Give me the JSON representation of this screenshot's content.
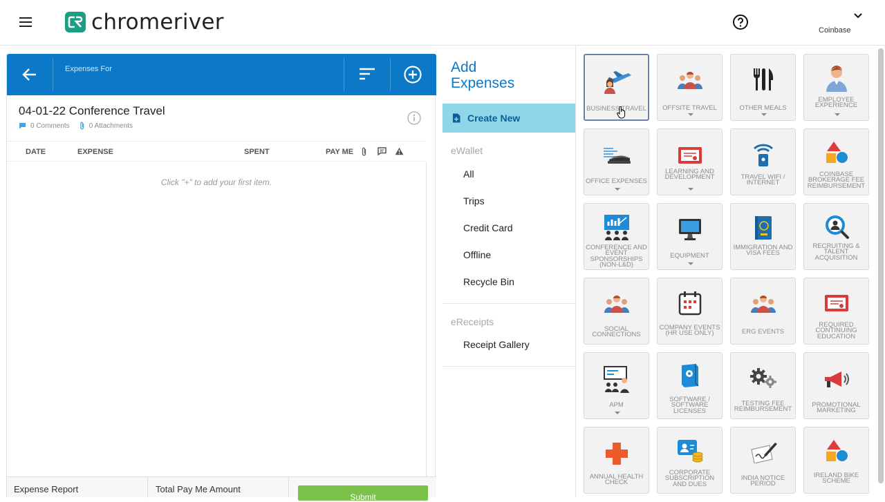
{
  "header": {
    "brand": "chromeriver",
    "account": "Coinbase"
  },
  "report": {
    "expenses_for_label": "Expenses For",
    "title": "04-01-22 Conference Travel",
    "comments": "0 Comments",
    "attachments": "0 Attachments",
    "columns": {
      "date": "DATE",
      "expense": "EXPENSE",
      "spent": "SPENT",
      "pay_me": "PAY ME"
    },
    "empty_message": "Click \"+\" to add your first item.",
    "footer": {
      "expense_report": "Expense Report",
      "total_pay_me": "Total Pay Me Amount",
      "submit": "Submit"
    }
  },
  "add_panel": {
    "title_line1": "Add",
    "title_line2": "Expenses",
    "create_new": "Create New",
    "ewallet_header": "eWallet",
    "ewallet_items": [
      "All",
      "Trips",
      "Credit Card",
      "Offline",
      "Recycle Bin"
    ],
    "ereceipts_header": "eReceipts",
    "ereceipts_items": [
      "Receipt Gallery"
    ]
  },
  "tiles": [
    {
      "label": "BUSINESS TRAVEL",
      "icon": "business-travel-icon",
      "caret": false,
      "selected": true
    },
    {
      "label": "OFFSITE TRAVEL",
      "icon": "group-people-icon",
      "caret": true
    },
    {
      "label": "OTHER MEALS",
      "icon": "fork-knife-icon",
      "caret": true
    },
    {
      "label": "EMPLOYEE EXPERIENCE",
      "icon": "person-icon",
      "caret": true
    },
    {
      "label": "OFFICE EXPENSES",
      "icon": "stapler-icon",
      "caret": true
    },
    {
      "label": "LEARNING AND DEVELOPMENT",
      "icon": "certificate-icon",
      "caret": true
    },
    {
      "label": "TRAVEL WIFI / INTERNET",
      "icon": "wifi-icon",
      "caret": false
    },
    {
      "label": "COINBASE BROKERAGE FEE REIMBURSEMENT",
      "icon": "shapes-icon",
      "caret": false
    },
    {
      "label": "CONFERENCE AND EVENT SPONSORSHIPS (NON-L&D)",
      "icon": "conference-icon",
      "caret": false
    },
    {
      "label": "EQUIPMENT",
      "icon": "monitor-icon",
      "caret": true
    },
    {
      "label": "IMMIGRATION AND VISA FEES",
      "icon": "passport-icon",
      "caret": false
    },
    {
      "label": "RECRUITING & TALENT ACQUISITION",
      "icon": "recruiting-icon",
      "caret": false
    },
    {
      "label": "SOCIAL CONNECTIONS",
      "icon": "group-people-icon",
      "caret": false
    },
    {
      "label": "COMPANY EVENTS (HR USE ONLY)",
      "icon": "calendar-icon",
      "caret": false
    },
    {
      "label": "ERG EVENTS",
      "icon": "group-people-icon",
      "caret": false
    },
    {
      "label": "REQUIRED CONTINUING EDUCATION",
      "icon": "certificate-icon",
      "caret": false
    },
    {
      "label": "APM",
      "icon": "presentation-icon",
      "caret": true
    },
    {
      "label": "SOFTWARE / SOFTWARE LICENSES",
      "icon": "software-box-icon",
      "caret": false
    },
    {
      "label": "TESTING FEE REIMBURSEMENT",
      "icon": "gears-icon",
      "caret": false
    },
    {
      "label": "PROMOTIONAL MARKETING",
      "icon": "megaphone-icon",
      "caret": false
    },
    {
      "label": "ANNUAL HEALTH CHECK",
      "icon": "medical-cross-icon",
      "caret": false
    },
    {
      "label": "CORPORATE SUBSCRIPTION AND DUES",
      "icon": "subscription-icon",
      "caret": false
    },
    {
      "label": "INDIA NOTICE PERIOD",
      "icon": "signature-icon",
      "caret": false
    },
    {
      "label": "IRELAND BIKE SCHEME",
      "icon": "shapes-icon",
      "caret": false
    }
  ],
  "colors": {
    "brand_blue": "#0b78c8",
    "brand_green": "#1b9e84",
    "create_new_bg": "#8fd6ea",
    "submit_green": "#7cc24a"
  }
}
